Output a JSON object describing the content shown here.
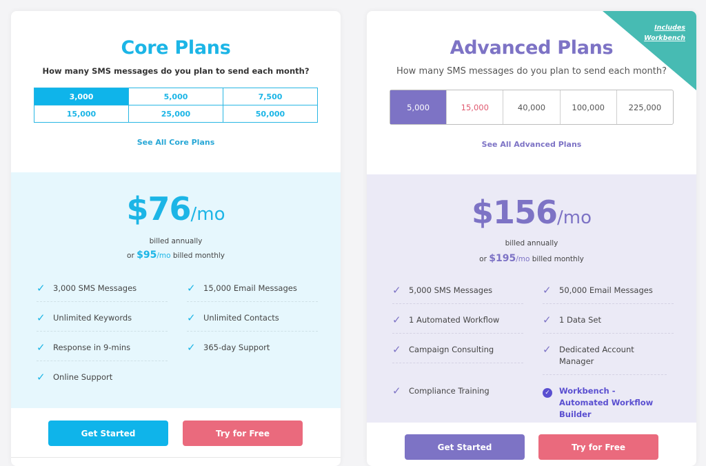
{
  "core": {
    "title": "Core Plans",
    "question": "How many SMS messages do you plan to send each month?",
    "options": [
      "3,000",
      "5,000",
      "7,500",
      "15,000",
      "25,000",
      "50,000"
    ],
    "selected_option": "3,000",
    "see_all": "See All Core Plans",
    "price": "$76",
    "unit": "/mo",
    "billed_annually": "billed annually",
    "or_text": "or",
    "monthly_price": "$95",
    "monthly_unit": "/mo",
    "billed_monthly": "billed monthly",
    "features": [
      "3,000 SMS Messages",
      "15,000 Email Messages",
      "Unlimited Keywords",
      "Unlimited Contacts",
      "Response in 9-mins",
      "365-day Support",
      "Online Support"
    ],
    "get_started": "Get Started",
    "try_free": "Try for Free",
    "accent_color": "#1cb5e6"
  },
  "advanced": {
    "badge_line1": "Includes",
    "badge_line2": "Workbench",
    "title": "Advanced Plans",
    "question": "How many SMS messages do you plan to send each month?",
    "options": [
      "5,000",
      "15,000",
      "40,000",
      "100,000",
      "225,000"
    ],
    "selected_option": "5,000",
    "see_all": "See All Advanced Plans",
    "price": "$156",
    "unit": "/mo",
    "billed_annually": "billed annually",
    "or_text": "or",
    "monthly_price": "$195",
    "monthly_unit": "/mo",
    "billed_monthly": "billed monthly",
    "features": [
      "5,000 SMS Messages",
      "50,000 Email Messages",
      "1 Automated Workflow",
      "1 Data Set",
      "Campaign Consulting",
      "Dedicated Account Manager",
      "Compliance Training",
      "Workbench - Automated Workflow Builder"
    ],
    "get_started": "Get Started",
    "try_free": "Try for Free",
    "accent_color": "#7d73c5",
    "badge_color": "#47bbb3"
  },
  "colors": {
    "try_free": "#ea6a7d"
  },
  "icons": {
    "check": "checkmark-icon",
    "highlight_check": "check-circle-icon"
  }
}
